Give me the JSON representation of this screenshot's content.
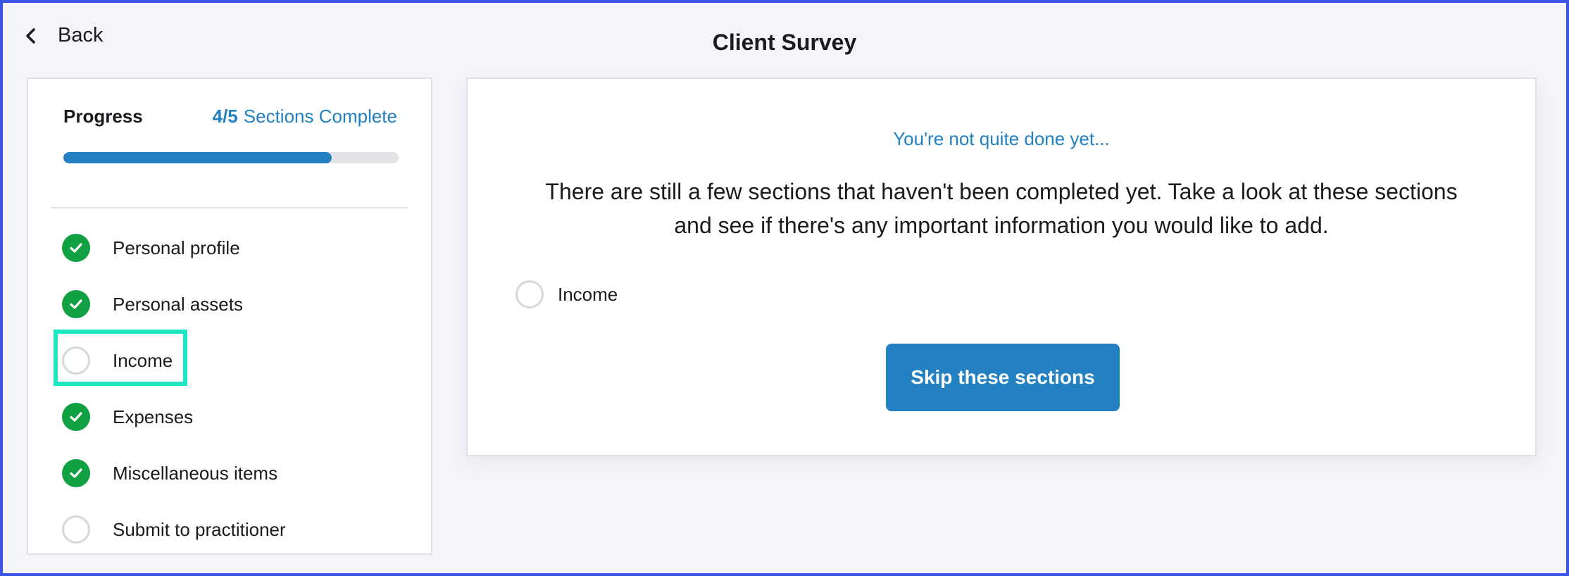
{
  "header": {
    "back_label": "Back",
    "title": "Client Survey"
  },
  "sidebar": {
    "progress_title": "Progress",
    "progress_count": "4/5",
    "progress_suffix": "Sections Complete",
    "progress_fraction": 0.8,
    "steps": [
      {
        "label": "Personal profile",
        "status": "complete",
        "icon": "check-circle-icon"
      },
      {
        "label": "Personal assets",
        "status": "complete",
        "icon": "check-circle-icon"
      },
      {
        "label": "Income",
        "status": "incomplete",
        "icon": "empty-circle-icon",
        "highlighted": true
      },
      {
        "label": "Expenses",
        "status": "complete",
        "icon": "check-circle-icon"
      },
      {
        "label": "Miscellaneous items",
        "status": "complete",
        "icon": "check-circle-icon"
      },
      {
        "label": "Submit to practitioner",
        "status": "incomplete",
        "icon": "empty-circle-icon"
      }
    ]
  },
  "main": {
    "eyebrow": "You're not quite done yet...",
    "message": "There are still a few sections that haven't been completed yet. Take a look at these sections and see if there's any important information you would like to add.",
    "incomplete_sections": [
      {
        "label": "Income"
      }
    ],
    "skip_button_label": "Skip these sections"
  },
  "colors": {
    "accent": "#2381c2",
    "complete": "#12a142",
    "highlight": "#1ee6c5",
    "frame": "#3b55e6"
  }
}
